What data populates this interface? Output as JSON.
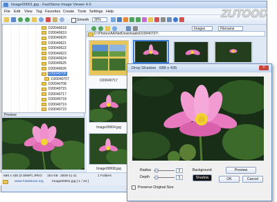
{
  "window": {
    "title": "Image00001.jpg - FastStone Image Viewer 4.0"
  },
  "menu": [
    "File",
    "Edit",
    "View",
    "Tag",
    "Favorites",
    "Create",
    "Tools",
    "Settings",
    "Help"
  ],
  "toolbar": {
    "smooth_label": "Smooth",
    "zoom_value": "30%",
    "view_value": "Images",
    "sort_value": "Filename"
  },
  "tree": {
    "items": [
      "D20040618",
      "D20040619",
      "D20040620",
      "D20040621",
      "D20040622",
      "D20040623",
      "D20040624",
      "D20040625",
      "D20040626",
      "D20040706",
      "D20040707",
      "D20040708",
      "D20040715",
      "D20040717",
      "D20040718",
      "D20040719",
      "D20040723"
    ],
    "selected_index": 9
  },
  "path": {
    "value": "D:\\Photos\\AA\\NetDownloads\\D20040707\\"
  },
  "preview": {
    "label": "Preview"
  },
  "thumbs": [
    {
      "label": "D20040717"
    },
    {
      "label": "Image00004.jpg"
    },
    {
      "label": "Image00008.jpg"
    }
  ],
  "status": {
    "dims": "688 x 435 (0.30MP) JPEG",
    "size": "164 KB",
    "date": "2009-11-11",
    "folders": "1 Folders",
    "website": "www.FastStone.org",
    "file": "Image00001.jpg [ 1 / 24 ]"
  },
  "dialog": {
    "title": "Drop Shadow",
    "dims": "688 x 435",
    "radius_label": "Radius",
    "radius_value": "3",
    "depth_label": "Depth",
    "depth_value": "3",
    "background_label": "Background",
    "shadow_label": "Shadow",
    "preview_button": "Preview",
    "ok_button": "OK",
    "cancel_button": "Cancel",
    "preserve_label": "Preserve Original Size"
  },
  "logo": {
    "text": "ZUTOOD"
  },
  "colors": {
    "accent": "#3b78d4",
    "title_bar": "#c2d5ee",
    "flower_pink": "#e87ac0",
    "flower_center": "#f2d431",
    "leaf_green": "#2f5a24"
  }
}
